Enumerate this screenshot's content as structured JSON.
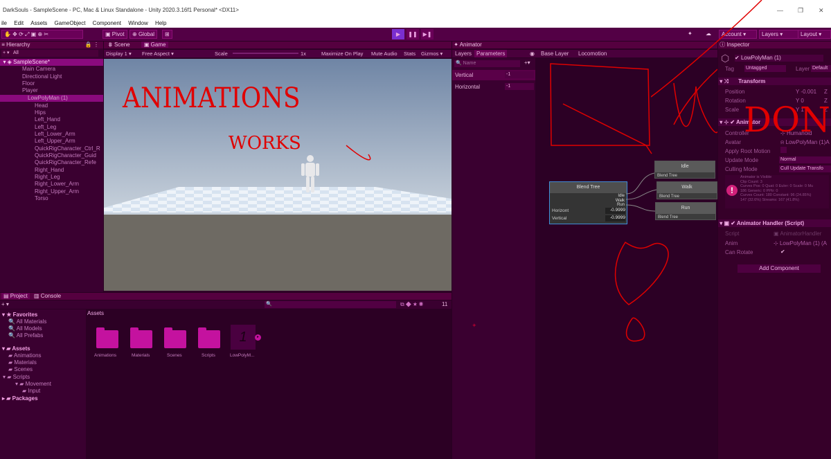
{
  "window": {
    "title": "DarkSouls - SampleScene - PC, Mac & Linux Standalone - Unity 2020.3.16f1 Personal* <DX11>",
    "controls": [
      "—",
      "❐",
      "✕"
    ]
  },
  "menu": [
    "ile",
    "Edit",
    "Assets",
    "GameObject",
    "Component",
    "Window",
    "Help"
  ],
  "toolbar": {
    "pivot": "Pivot",
    "global": "Global",
    "account": "Account",
    "layers": "Layers",
    "layout": "Layout"
  },
  "hierarchy": {
    "tab": "Hierarchy",
    "search": "All",
    "scene": "SampleScene*",
    "items": [
      "Main Camera",
      "Directional Light",
      "Floor",
      "Player",
      "LowPolyMan (1)",
      "Head",
      "Hips",
      "Left_Hand",
      "Left_Leg",
      "Left_Lower_Arm",
      "Left_Upper_Arm",
      "QuickRigCharacter_Ctrl_R",
      "QuickRigCharacter_Guid",
      "QuickRigCharacter_Refe",
      "Right_Hand",
      "Right_Leg",
      "Right_Lower_Arm",
      "Right_Upper_Arm",
      "Torso"
    ]
  },
  "game": {
    "tab_scene": "Scene",
    "tab_game": "Game",
    "display": "Display 1",
    "aspect": "Free Aspect",
    "scale_label": "Scale",
    "scale_value": "1x",
    "maximize": "Maximize On Play",
    "mute": "Mute Audio",
    "stats": "Stats",
    "gizmos": "Gizmos"
  },
  "animator": {
    "tab": "Animator",
    "tab_layers": "Layers",
    "tab_params": "Parameters",
    "search_placeholder": "Name",
    "base_layer": "Base Layer",
    "locomotion": "Locomotion",
    "params": [
      {
        "name": "Vertical",
        "value": "-1"
      },
      {
        "name": "Horizontal",
        "value": "-1"
      }
    ],
    "blend_tree": {
      "title": "Blend Tree",
      "outputs": [
        "Idle",
        "Walk",
        "Run"
      ],
      "inputs": [
        {
          "name": "Horizont",
          "value": "-0.9999"
        },
        {
          "name": "Vertical",
          "value": "-0.9999"
        }
      ]
    },
    "states": [
      {
        "name": "Idle",
        "sub": "Blend Tree"
      },
      {
        "name": "Walk",
        "sub": "Blend Tree"
      },
      {
        "name": "Run",
        "sub": "Blend Tree"
      }
    ]
  },
  "inspector": {
    "tab": "Inspector",
    "object_name": "LowPolyMan (1)",
    "tag_label": "Tag",
    "tag": "Untagged",
    "layer_label": "Layer",
    "layer": "Default",
    "transform": {
      "title": "Transform",
      "rows": [
        {
          "label": "Position",
          "y": "-0.001",
          "z": "Z"
        },
        {
          "label": "Rotation",
          "y": "0",
          "z": "Z"
        },
        {
          "label": "Scale",
          "y": "1",
          "z": "Z"
        }
      ]
    },
    "animator": {
      "title": "Animator",
      "fields": [
        {
          "label": "Controller",
          "value": "Humanoid"
        },
        {
          "label": "Avatar",
          "value": "LowPolyMan (1)A"
        },
        {
          "label": "Apply Root Motion",
          "value": ""
        },
        {
          "label": "Update Mode",
          "value": "Normal"
        },
        {
          "label": "Culling Mode",
          "value": "Cull Update Transfo"
        }
      ],
      "info": [
        "Animator is Visible",
        "Clip Count: 3",
        "Curves Pos: 0 Quat: 0 Euler: 0 Scale: 0 Mu",
        "186 Generic: 0 PPtr: 0",
        "Curves Count: 180 Constant: 96 (24.85%)",
        "147 (32.6%) Streams: 167 (41.8%)"
      ]
    },
    "handler": {
      "title": "Animator Handler (Script)",
      "fields": [
        {
          "label": "Script",
          "value": "AnimatorHandler"
        },
        {
          "label": "Anim",
          "value": "LowPolyMan (1) (A"
        },
        {
          "label": "Can Rotate",
          "value": "✔"
        }
      ]
    },
    "add_component": "Add Component"
  },
  "project": {
    "tab_project": "Project",
    "tab_console": "Console",
    "favorites": "Favorites",
    "fav_items": [
      "All Materials",
      "All Models",
      "All Prefabs"
    ],
    "assets_root": "Assets",
    "tree": [
      "Animations",
      "Materials",
      "Scenes",
      "Scripts",
      "Movement",
      "Input"
    ],
    "packages": "Packages",
    "crumb": "Assets",
    "files": [
      "Animations",
      "Materials",
      "Scenes",
      "Scripts",
      "LowPolyM..."
    ],
    "count": "11"
  },
  "annotations": [
    "ANIMATIONS",
    "WORKS",
    "DONE"
  ]
}
